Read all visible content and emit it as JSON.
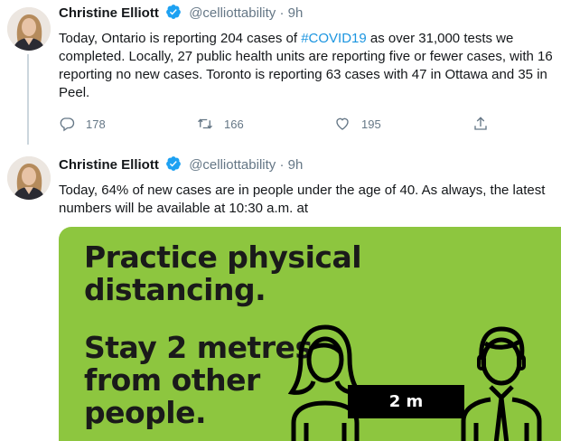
{
  "tweets": [
    {
      "name": "Christine Elliott",
      "handle": "@celliottability",
      "separator": "·",
      "time": "9h",
      "text_parts": [
        "Today, Ontario is reporting 204 cases of ",
        "#COVID19",
        " as over 31,000 tests we completed. Locally, 27 public health units are reporting five or fewer cases, with 16 reporting no new cases. Toronto is reporting 63 cases with 47 in Ottawa and 35 in Peel."
      ],
      "replies": "178",
      "retweets": "166",
      "likes": "195"
    },
    {
      "name": "Christine Elliott",
      "handle": "@celliottability",
      "separator": "·",
      "time": "9h",
      "text": "Today, 64% of new cases are in people under the age of 40. As always, the latest numbers will be available at 10:30 a.m. at",
      "media": {
        "heading_line1": "Practice physical",
        "heading_line2": "distancing.",
        "sub_line1": "Stay 2 metres",
        "sub_line2": "from other",
        "sub_line3": "people.",
        "distance_label": "2 m",
        "background_color": "#8dc63f"
      }
    }
  ],
  "colors": {
    "accent": "#1b95e0",
    "muted": "#657786",
    "verified": "#1da1f2"
  }
}
